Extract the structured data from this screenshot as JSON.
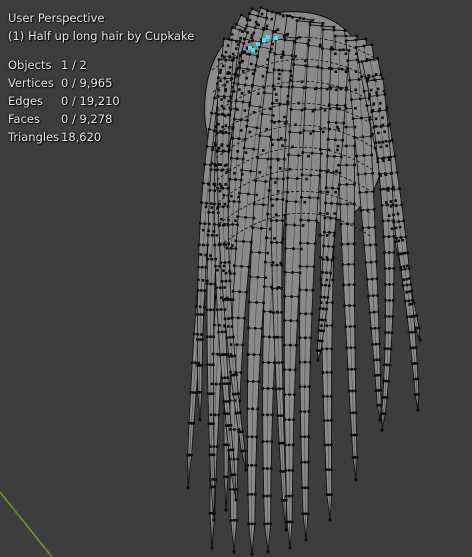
{
  "viewport": {
    "view_name": "User Perspective",
    "object_name": "(1) Half up long hair by Cupkake",
    "stats": [
      {
        "label": "Objects",
        "value": "1 / 2"
      },
      {
        "label": "Vertices",
        "value": "0 / 9,965"
      },
      {
        "label": "Edges",
        "value": "0 / 19,210"
      },
      {
        "label": "Faces",
        "value": "0 / 9,278"
      },
      {
        "label": "Triangles",
        "value": "18,620"
      }
    ]
  },
  "colors": {
    "background": "#3d3d3d",
    "mesh_fill": "#8a8a8a",
    "mesh_edge": "#0d0d0d",
    "grid_line": "#474747",
    "axis_line": "#6b9a2c",
    "selected_vertex": "#40e0ff"
  },
  "icons": {
    "mesh_object": "hair-mesh-icon"
  }
}
